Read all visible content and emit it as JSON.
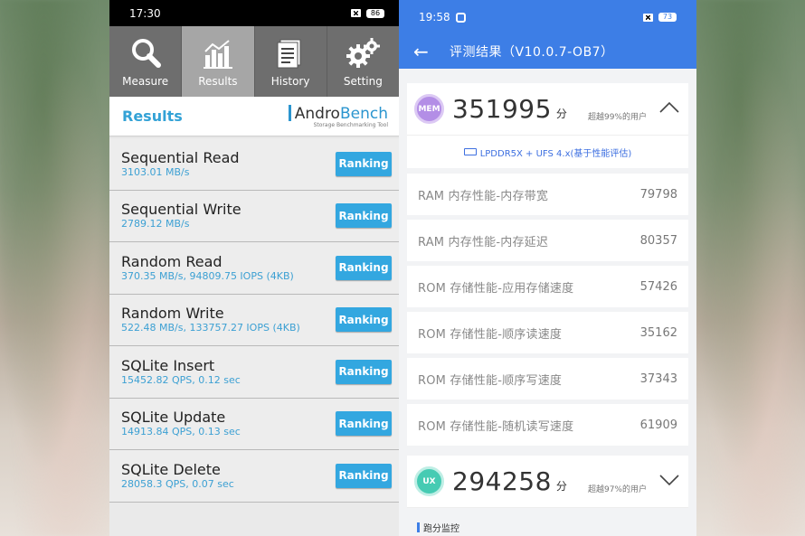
{
  "left": {
    "status": {
      "time": "17:30",
      "battery": "86"
    },
    "tabs": [
      {
        "label": "Measure",
        "icon": "magnifier-icon",
        "active": false
      },
      {
        "label": "Results",
        "icon": "bar-chart-icon",
        "active": true
      },
      {
        "label": "History",
        "icon": "document-icon",
        "active": false
      },
      {
        "label": "Setting",
        "icon": "gear-icon",
        "active": false
      }
    ],
    "header": {
      "title": "Results",
      "logo_part1": "Andro",
      "logo_part2": "Bench",
      "logo_sub": "Storage Benchmarking Tool"
    },
    "ranking_label": "Ranking",
    "results": [
      {
        "name": "Sequential Read",
        "value": "3103.01 MB/s"
      },
      {
        "name": "Sequential Write",
        "value": "2789.12 MB/s"
      },
      {
        "name": "Random Read",
        "value": "370.35 MB/s, 94809.75 IOPS (4KB)"
      },
      {
        "name": "Random Write",
        "value": "522.48 MB/s, 133757.27 IOPS (4KB)"
      },
      {
        "name": "SQLite Insert",
        "value": "15452.82 QPS, 0.12 sec"
      },
      {
        "name": "SQLite Update",
        "value": "14913.84 QPS, 0.13 sec"
      },
      {
        "name": "SQLite Delete",
        "value": "28058.3 QPS, 0.07 sec"
      }
    ]
  },
  "right": {
    "status": {
      "time": "19:58",
      "battery": "73"
    },
    "title": "评测结果（V10.0.7-OB7）",
    "mem": {
      "badge": "MEM",
      "score": "351995",
      "unit": "分",
      "percentile": "超越99%的用户"
    },
    "device_line": "LPDDR5X + UFS 4.x(基于性能评估)",
    "metrics": [
      {
        "label": "RAM 内存性能-内存带宽",
        "value": "79798"
      },
      {
        "label": "RAM 内存性能-内存延迟",
        "value": "80357"
      },
      {
        "label": "ROM 存储性能-应用存储速度",
        "value": "57426"
      },
      {
        "label": "ROM 存储性能-顺序读速度",
        "value": "35162"
      },
      {
        "label": "ROM 存储性能-顺序写速度",
        "value": "37343"
      },
      {
        "label": "ROM 存储性能-随机读写速度",
        "value": "61909"
      }
    ],
    "ux": {
      "badge": "UX",
      "score": "294258",
      "unit": "分",
      "percentile": "超越97%的用户"
    },
    "section": "跑分监控"
  },
  "colors": {
    "andro_blue": "#33a7e0",
    "antutu_blue": "#3d7ee6",
    "mem_purple": "#b38ee6",
    "ux_teal": "#46cbb3"
  }
}
